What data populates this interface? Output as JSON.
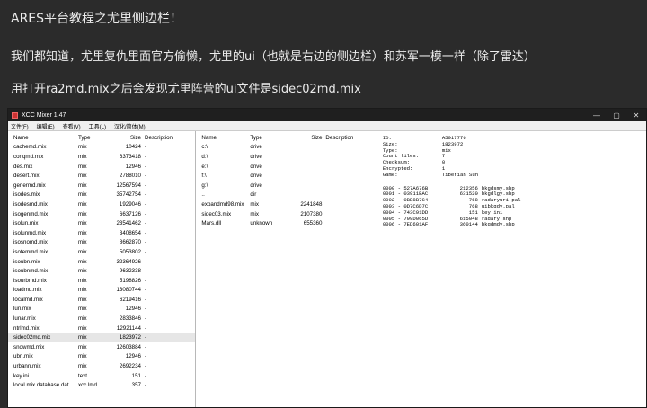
{
  "post": {
    "line1": "ARES平台教程之尤里侧边栏！",
    "line2": "我们都知道，尤里复仇里面官方偷懒，尤里的ui（也就是右边的侧边栏）和苏军一模一样（除了雷达）",
    "line3": "用打开ra2md.mix之后会发现尤里阵营的ui文件是sidec02md.mix"
  },
  "window": {
    "title": "XCC Mixer 1.47",
    "controls": {
      "minimize": "—",
      "maximize": "▢",
      "close": "✕"
    },
    "menu": [
      "文件(F)",
      "编辑(E)",
      "查看(V)",
      "工具(L)",
      "汉化/简体(M)"
    ]
  },
  "pane1": {
    "headers": {
      "name": "Name",
      "type": "Type",
      "size": "Size",
      "desc": "Description"
    },
    "rows": [
      {
        "name": "cachemd.mix",
        "type": "mix",
        "size": "10424",
        "desc": "-"
      },
      {
        "name": "conqmd.mix",
        "type": "mix",
        "size": "6373418",
        "desc": "-"
      },
      {
        "name": "des.mix",
        "type": "mix",
        "size": "12946",
        "desc": "-"
      },
      {
        "name": "desert.mix",
        "type": "mix",
        "size": "2788010",
        "desc": "-"
      },
      {
        "name": "genermd.mix",
        "type": "mix",
        "size": "12567594",
        "desc": "-"
      },
      {
        "name": "isodes.mix",
        "type": "mix",
        "size": "35742754",
        "desc": "-"
      },
      {
        "name": "isodesmd.mix",
        "type": "mix",
        "size": "1929046",
        "desc": "-"
      },
      {
        "name": "isogenmd.mix",
        "type": "mix",
        "size": "6637126",
        "desc": "-"
      },
      {
        "name": "isolun.mix",
        "type": "mix",
        "size": "23541462",
        "desc": "-"
      },
      {
        "name": "isolunmd.mix",
        "type": "mix",
        "size": "3408654",
        "desc": "-"
      },
      {
        "name": "isosnomd.mix",
        "type": "mix",
        "size": "8662870",
        "desc": "-"
      },
      {
        "name": "isotemmd.mix",
        "type": "mix",
        "size": "5053802",
        "desc": "-"
      },
      {
        "name": "isoubn.mix",
        "type": "mix",
        "size": "32364926",
        "desc": "-"
      },
      {
        "name": "isoubnmd.mix",
        "type": "mix",
        "size": "9632338",
        "desc": "-"
      },
      {
        "name": "isourbmd.mix",
        "type": "mix",
        "size": "5198826",
        "desc": "-"
      },
      {
        "name": "loadmd.mix",
        "type": "mix",
        "size": "13080744",
        "desc": "-"
      },
      {
        "name": "localmd.mix",
        "type": "mix",
        "size": "6219416",
        "desc": "-"
      },
      {
        "name": "lun.mix",
        "type": "mix",
        "size": "12946",
        "desc": "-"
      },
      {
        "name": "lunar.mix",
        "type": "mix",
        "size": "2833846",
        "desc": "-"
      },
      {
        "name": "ntrlmd.mix",
        "type": "mix",
        "size": "12921144",
        "desc": "-"
      },
      {
        "name": "sidec02md.mix",
        "type": "mix",
        "size": "1823972",
        "desc": "-"
      },
      {
        "name": "snowmd.mix",
        "type": "mix",
        "size": "12603884",
        "desc": "-"
      },
      {
        "name": "ubn.mix",
        "type": "mix",
        "size": "12946",
        "desc": "-"
      },
      {
        "name": "urbann.mix",
        "type": "mix",
        "size": "2692234",
        "desc": "-"
      },
      {
        "name": "key.ini",
        "type": "text",
        "size": "151",
        "desc": "-"
      },
      {
        "name": "local mix database.dat",
        "type": "xcc lmd",
        "size": "357",
        "desc": "-"
      }
    ],
    "selected_index": 20
  },
  "pane2": {
    "headers": {
      "name": "Name",
      "type": "Type",
      "size": "Size",
      "desc": "Description"
    },
    "rows": [
      {
        "name": "c:\\",
        "type": "drive",
        "size": "",
        "desc": ""
      },
      {
        "name": "d:\\",
        "type": "drive",
        "size": "",
        "desc": ""
      },
      {
        "name": "e:\\",
        "type": "drive",
        "size": "",
        "desc": ""
      },
      {
        "name": "f:\\",
        "type": "drive",
        "size": "",
        "desc": ""
      },
      {
        "name": "g:\\",
        "type": "drive",
        "size": "",
        "desc": ""
      },
      {
        "name": "..",
        "type": "dir",
        "size": "",
        "desc": ""
      },
      {
        "name": "expandmd98.mix",
        "type": "mix",
        "size": "2241848",
        "desc": ""
      },
      {
        "name": "sidec03.mix",
        "type": "mix",
        "size": "2107380",
        "desc": ""
      },
      {
        "name": "Mars.dll",
        "type": "unknown",
        "size": "655360",
        "desc": ""
      }
    ]
  },
  "pane3": {
    "info": [
      {
        "k": "ID:",
        "v": "A5017776"
      },
      {
        "k": "Size:",
        "v": "1823972"
      },
      {
        "k": "Type:",
        "v": "mix"
      },
      {
        "k": "Count files:",
        "v": "7"
      },
      {
        "k": "Checksum:",
        "v": "0"
      },
      {
        "k": "Encrypted:",
        "v": "1"
      },
      {
        "k": "Game:",
        "v": "Tiberian Sun"
      }
    ],
    "entries": [
      {
        "id": "0000 - 527A676B",
        "size": "212356",
        "name": "bkgdsmy.shp"
      },
      {
        "id": "0001 - 03911BAC",
        "size": "631520",
        "name": "bkgdlgy.shp"
      },
      {
        "id": "0002 - 0BE8B7C4",
        "size": "768",
        "name": "radaryuri.pal"
      },
      {
        "id": "0003 - 0D7C6D7C",
        "size": "768",
        "name": "uibkgdy.pal"
      },
      {
        "id": "0004 - 743C91DD",
        "size": "151",
        "name": "key.ini"
      },
      {
        "id": "0005 - 799D065D",
        "size": "615048",
        "name": "radary.shp"
      },
      {
        "id": "0006 - 7ED601AF",
        "size": "360144",
        "name": "bkgdmdy.shp"
      }
    ]
  }
}
